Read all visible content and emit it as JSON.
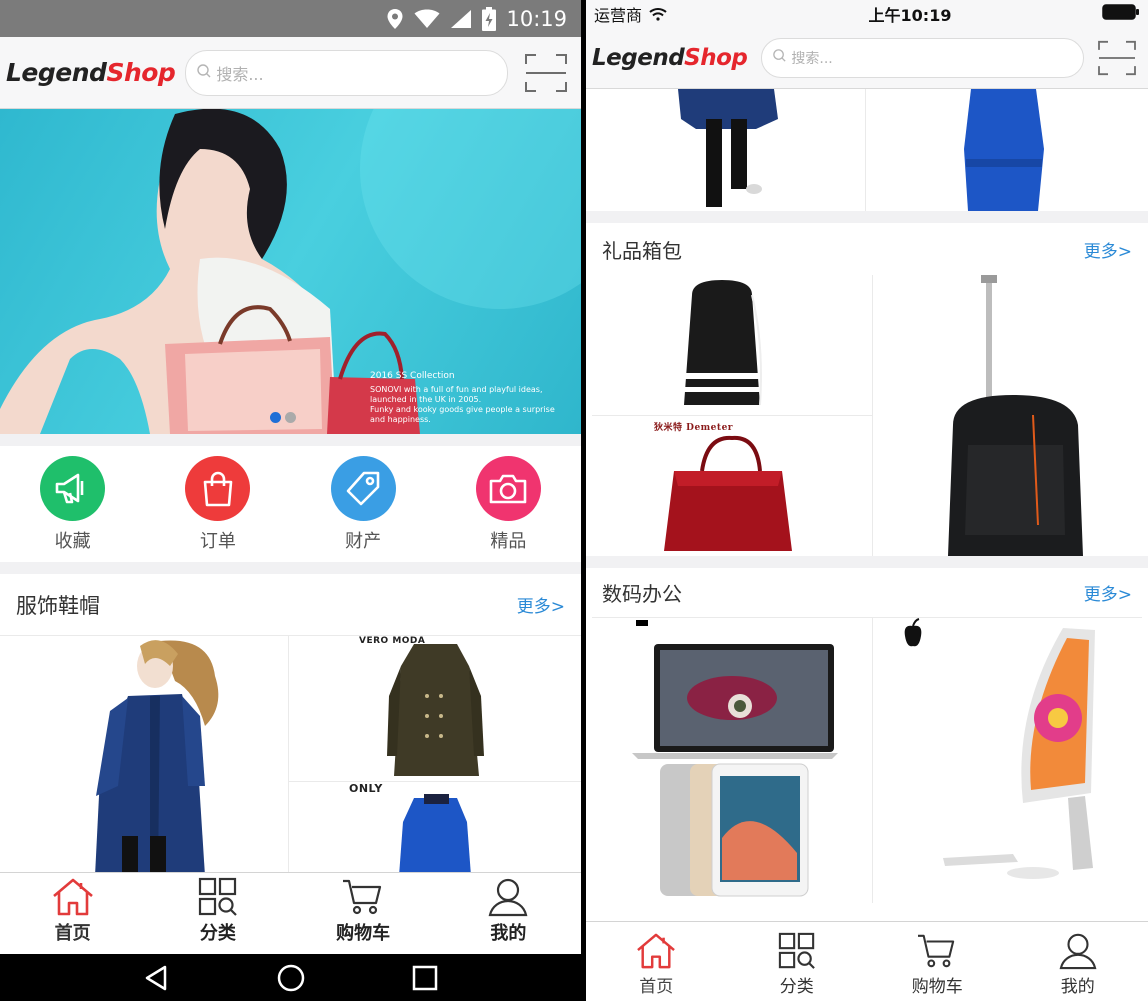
{
  "left_phone": {
    "status_bar": {
      "time": "10:19"
    },
    "header": {
      "logo_legend": "Legend",
      "logo_shop": "Shop",
      "search_placeholder": "搜索..."
    },
    "banner": {
      "caption_title": "2016 SS Collection",
      "caption_lines": [
        "SONOVI with a full of fun and playful ideas,",
        "launched in the UK in 2005.",
        "Funky and kooky goods give people a surprise and happiness."
      ],
      "active_slide": 1,
      "slide_count": 2
    },
    "quick_links": [
      {
        "label": "收藏",
        "icon": "megaphone-icon",
        "color": "#1fbf6b"
      },
      {
        "label": "订单",
        "icon": "shopping-bag-icon",
        "color": "#ee3b3b"
      },
      {
        "label": "财产",
        "icon": "tag-icon",
        "color": "#3a9ee4"
      },
      {
        "label": "精品",
        "icon": "camera-icon",
        "color": "#f0346f"
      }
    ],
    "section": {
      "title": "服饰鞋帽",
      "more": "更多>",
      "brand_labels": [
        "VERO MODA",
        "ONLY"
      ]
    },
    "tabs": [
      {
        "label": "首页",
        "icon": "home-icon",
        "active": true
      },
      {
        "label": "分类",
        "icon": "category-grid-icon",
        "active": false
      },
      {
        "label": "购物车",
        "icon": "cart-icon",
        "active": false
      },
      {
        "label": "我的",
        "icon": "user-icon",
        "active": false
      }
    ]
  },
  "right_phone": {
    "status_bar": {
      "carrier": "运营商",
      "time": "上午10:19"
    },
    "header": {
      "logo_legend": "Legend",
      "logo_shop": "Shop",
      "search_placeholder": "搜索..."
    },
    "sections": [
      {
        "title": "礼品箱包",
        "more": "更多>",
        "brand_label": "狄米特 Demeter"
      },
      {
        "title": "数码办公",
        "more": "更多>"
      }
    ],
    "tabs": [
      {
        "label": "首页",
        "icon": "home-icon",
        "active": true
      },
      {
        "label": "分类",
        "icon": "category-grid-icon",
        "active": false
      },
      {
        "label": "购物车",
        "icon": "cart-icon",
        "active": false
      },
      {
        "label": "我的",
        "icon": "user-icon",
        "active": false
      }
    ]
  },
  "colors": {
    "brand_red": "#e5262d",
    "link_blue": "#2b8ad6",
    "banner_cyan": "#3cc4d8"
  }
}
